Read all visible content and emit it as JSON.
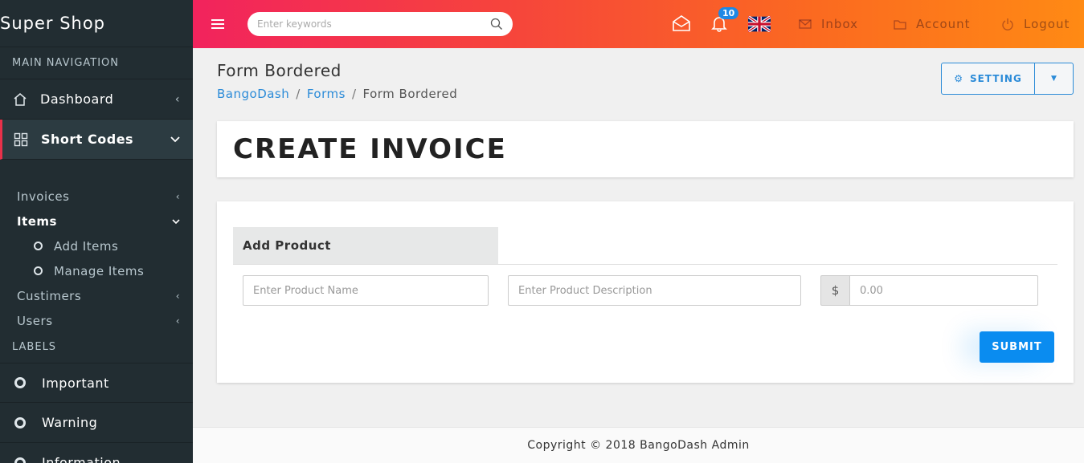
{
  "brand": "Super Shop",
  "sidebar": {
    "main_header": "MAIN NAVIGATION",
    "dashboard": "Dashboard",
    "short_codes": "Short Codes",
    "submenu": {
      "invoices": "Invoices",
      "items": "Items",
      "add_items": "Add Items",
      "manage_items": "Manage Items",
      "customers": "Custimers",
      "users": "Users"
    },
    "labels_header": "LABELS",
    "labels": [
      "Important",
      "Warning",
      "Information"
    ]
  },
  "topbar": {
    "search_placeholder": "Enter keywords",
    "notification_count": "10",
    "inbox": "Inbox",
    "account": "Account",
    "logout": "Logout"
  },
  "page": {
    "title": "Form Bordered",
    "breadcrumb": [
      "BangoDash",
      "Forms",
      "Form Bordered"
    ],
    "setting_label": "SETTING"
  },
  "invoice": {
    "heading": "CREATE INVOICE",
    "tab": "Add Product",
    "product_name_placeholder": "Enter Product Name",
    "product_desc_placeholder": "Enter Product Description",
    "currency_symbol": "$",
    "price_placeholder": "0.00",
    "submit": "SUBMIT"
  },
  "footer": "Copyright © 2018 BangoDash Admin",
  "colors": {
    "accent": "#0a8cf0",
    "sidebar_bg": "#222d32",
    "active_marker": "#e8314a",
    "topbar_start": "#f2235d",
    "topbar_end": "#ff8a14"
  }
}
